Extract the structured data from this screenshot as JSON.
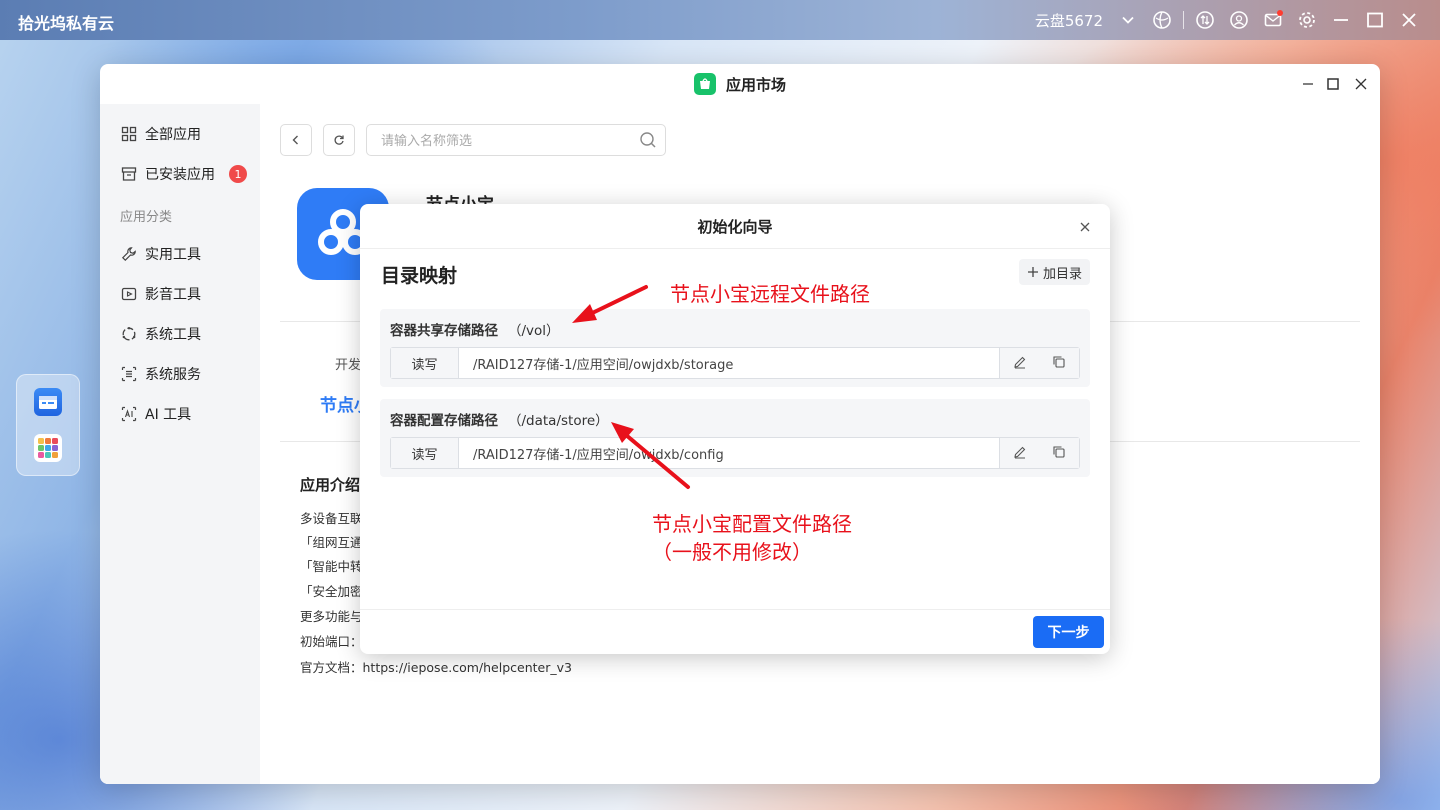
{
  "system_bar": {
    "brand": "拾光坞私有云",
    "disk_name": "云盘5672",
    "icons": [
      "chevron-down-icon",
      "network-icon",
      "transfer-icon",
      "user-icon",
      "mail-icon",
      "gear-icon",
      "minimize-icon",
      "maximize-icon",
      "close-icon"
    ]
  },
  "window": {
    "title": "应用市场",
    "logo_icon": "app-store-icon"
  },
  "sidebar": {
    "all_apps": "全部应用",
    "installed_apps": "已安装应用",
    "installed_badge": "1",
    "category_title": "应用分类",
    "categories": [
      "实用工具",
      "影音工具",
      "系统工具",
      "系统服务",
      "AI 工具"
    ]
  },
  "toolbar": {
    "search_placeholder": "请输入名称筛选"
  },
  "app": {
    "name": "节点小宝",
    "dev_label_fragment": "开发",
    "link_fragment": "节点小",
    "intro_title": "应用介绍",
    "intro_lines": [
      "多设备互联",
      "「组网互通",
      "「智能中转",
      "「安全加密",
      "更多功能与",
      "初始端口：",
      "官方文档：https://iepose.com/helpcenter_v3"
    ]
  },
  "wizard": {
    "title": "初始化向导",
    "section_title": "目录映射",
    "add_dir_label": "加目录",
    "mappings": [
      {
        "label": "容器共享存储路径",
        "mount": "（/vol）",
        "mode": "读写",
        "path": "/RAID127存储-1/应用空间/owjdxb/storage"
      },
      {
        "label": "容器配置存储路径",
        "mount": "（/data/store）",
        "mode": "读写",
        "path": "/RAID127存储-1/应用空间/owjdxb/config"
      }
    ],
    "next_label": "下一步"
  },
  "annotations": {
    "remote_path_note": "节点小宝远程文件路径",
    "config_path_note_line1": "节点小宝配置文件路径",
    "config_path_note_line2": "（一般不用修改）",
    "color": "#e8111b"
  },
  "colors": {
    "primary": "#1a6cf5",
    "badge": "#f04a4a",
    "app_icon": "#2f7cf6",
    "store_logo": "#18c26a"
  }
}
